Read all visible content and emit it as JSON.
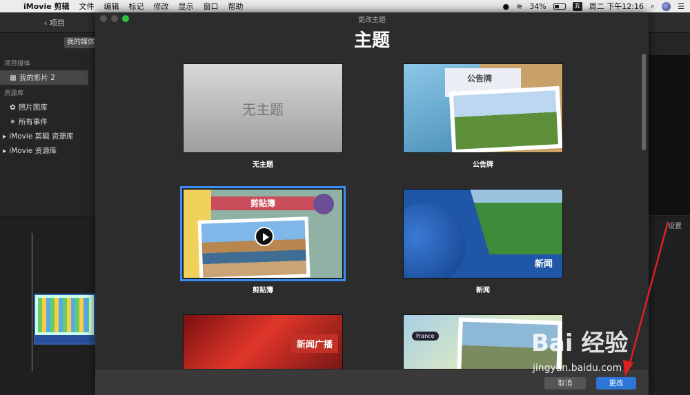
{
  "menubar": {
    "app_name": "iMovie 剪辑",
    "items": [
      "文件",
      "编辑",
      "标记",
      "修改",
      "显示",
      "窗口",
      "帮助"
    ],
    "battery": "34%",
    "ime": "五",
    "clock": "周二 下午12:16"
  },
  "background": {
    "back_label": "项目",
    "segment_label": "我的媒体",
    "sidebar": {
      "project_media_header": "项目媒体",
      "project_item": "我的影片 2",
      "library_header": "资源库",
      "photos": "照片图库",
      "all_events": "所有事件",
      "library1": "iMovie 剪辑 资源库",
      "library2": "iMovie 资源库"
    },
    "settings_label": "设置"
  },
  "dialog": {
    "window_title": "更改主题",
    "heading": "主题",
    "themes": [
      {
        "label": "无主题",
        "thumb_text": "无主题"
      },
      {
        "label": "公告牌",
        "thumb_text": "公告牌"
      },
      {
        "label": "剪贴簿",
        "thumb_text": "剪贴簿"
      },
      {
        "label": "新闻",
        "thumb_text": "新闻"
      },
      {
        "label": "",
        "thumb_text": "新闻广播"
      },
      {
        "label": "",
        "thumb_text": "France"
      }
    ],
    "cancel_label": "取消",
    "change_label": "更改"
  },
  "watermark": {
    "brand": "Bai 经验",
    "url": "jingyan.baidu.com"
  },
  "colors": {
    "accent": "#2d76d8",
    "selection": "#3a8ef6",
    "arrow": "#e02020"
  }
}
